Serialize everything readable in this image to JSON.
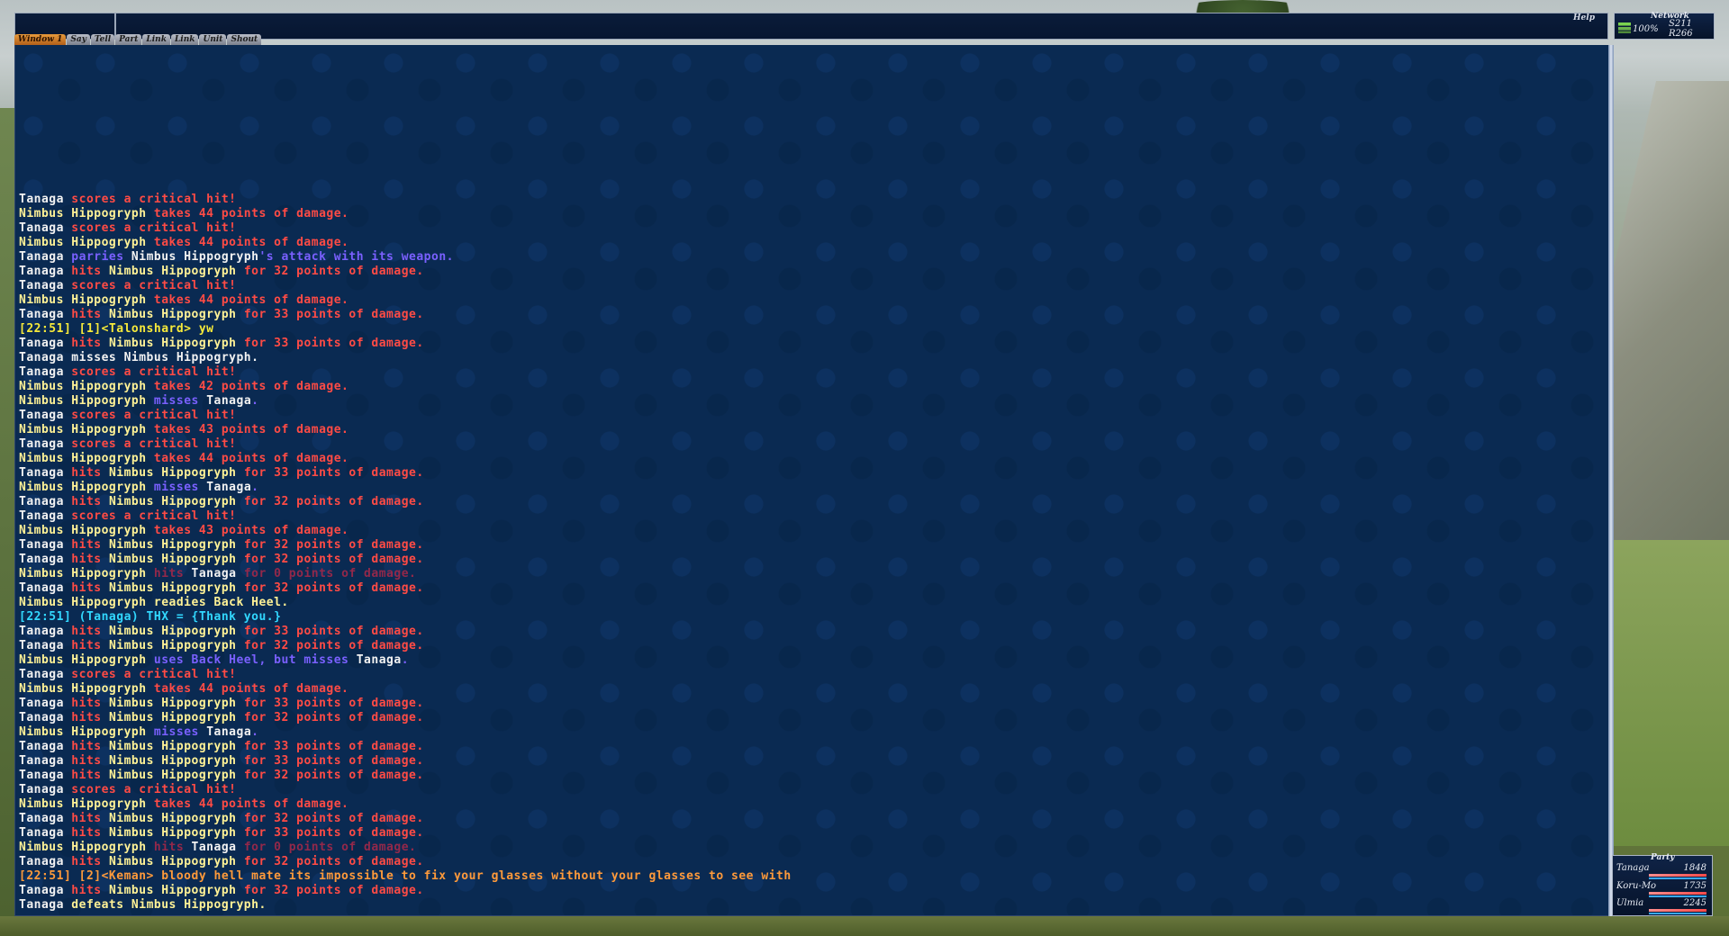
{
  "header": {
    "help_label": "Help"
  },
  "tabs": [
    {
      "label": "Window 1",
      "active": true
    },
    {
      "label": "Say"
    },
    {
      "label": "Tell"
    },
    {
      "label": "Part"
    },
    {
      "label": "Link"
    },
    {
      "label": "Link"
    },
    {
      "label": "Unit"
    },
    {
      "label": "Shout"
    }
  ],
  "network": {
    "title": "Network",
    "percent": "100%",
    "s": "S211",
    "r": "R266"
  },
  "party": {
    "title": "Party",
    "members": [
      {
        "name": "Tanaga",
        "hp": "1848",
        "hp_fraction": 1.0
      },
      {
        "name": "Koru-Mo",
        "hp": "1735",
        "hp_fraction": 1.0
      },
      {
        "name": "Ulmia",
        "hp": "2245",
        "hp_fraction": 1.0
      }
    ]
  },
  "chat_colors": {
    "white": "#f2f2f2",
    "yellow": "#fff296",
    "red": "#ff4b45",
    "blue": "#7a60ff",
    "darkred": "#93284a",
    "cyan": "#32d8ff",
    "linkshell": "#f7ea3a",
    "linkshell2": "#ff9a3a"
  },
  "chat_lines": [
    [
      [
        "w",
        "Tanaga "
      ],
      [
        "r",
        "scores a critical hit!"
      ]
    ],
    [
      [
        "y",
        "Nimbus Hippogryph "
      ],
      [
        "r",
        "takes 44 points of damage."
      ]
    ],
    [
      [
        "w",
        "Tanaga "
      ],
      [
        "r",
        "scores a critical hit!"
      ]
    ],
    [
      [
        "y",
        "Nimbus Hippogryph "
      ],
      [
        "r",
        "takes 44 points of damage."
      ]
    ],
    [
      [
        "w",
        "Tanaga "
      ],
      [
        "b",
        "parries "
      ],
      [
        "w",
        "Nimbus Hippogryph"
      ],
      [
        "b",
        "'s attack with its weapon."
      ]
    ],
    [
      [
        "w",
        "Tanaga "
      ],
      [
        "r",
        "hits "
      ],
      [
        "y",
        "Nimbus Hippogryph "
      ],
      [
        "r",
        "for 32 points of damage."
      ]
    ],
    [
      [
        "w",
        "Tanaga "
      ],
      [
        "r",
        "scores a critical hit!"
      ]
    ],
    [
      [
        "y",
        "Nimbus Hippogryph "
      ],
      [
        "r",
        "takes 44 points of damage."
      ]
    ],
    [
      [
        "w",
        "Tanaga "
      ],
      [
        "r",
        "hits "
      ],
      [
        "y",
        "Nimbus Hippogryph "
      ],
      [
        "r",
        "for 33 points of damage."
      ]
    ],
    [
      [
        "yl",
        "[22:51] [1]<Talonshard> yw"
      ]
    ],
    [
      [
        "w",
        "Tanaga "
      ],
      [
        "r",
        "hits "
      ],
      [
        "y",
        "Nimbus Hippogryph "
      ],
      [
        "r",
        "for 33 points of damage."
      ]
    ],
    [
      [
        "w",
        "Tanaga misses Nimbus Hippogryph."
      ]
    ],
    [
      [
        "w",
        "Tanaga "
      ],
      [
        "r",
        "scores a critical hit!"
      ]
    ],
    [
      [
        "y",
        "Nimbus Hippogryph "
      ],
      [
        "r",
        "takes 42 points of damage."
      ]
    ],
    [
      [
        "y",
        "Nimbus Hippogryph "
      ],
      [
        "b",
        "misses "
      ],
      [
        "w",
        "Tanaga"
      ],
      [
        "b",
        "."
      ]
    ],
    [
      [
        "w",
        "Tanaga "
      ],
      [
        "r",
        "scores a critical hit!"
      ]
    ],
    [
      [
        "y",
        "Nimbus Hippogryph "
      ],
      [
        "r",
        "takes 43 points of damage."
      ]
    ],
    [
      [
        "w",
        "Tanaga "
      ],
      [
        "r",
        "scores a critical hit!"
      ]
    ],
    [
      [
        "y",
        "Nimbus Hippogryph "
      ],
      [
        "r",
        "takes 44 points of damage."
      ]
    ],
    [
      [
        "w",
        "Tanaga "
      ],
      [
        "r",
        "hits "
      ],
      [
        "y",
        "Nimbus Hippogryph "
      ],
      [
        "r",
        "for 33 points of damage."
      ]
    ],
    [
      [
        "y",
        "Nimbus Hippogryph "
      ],
      [
        "b",
        "misses "
      ],
      [
        "w",
        "Tanaga"
      ],
      [
        "b",
        "."
      ]
    ],
    [
      [
        "w",
        "Tanaga "
      ],
      [
        "r",
        "hits "
      ],
      [
        "y",
        "Nimbus Hippogryph "
      ],
      [
        "r",
        "for 32 points of damage."
      ]
    ],
    [
      [
        "w",
        "Tanaga "
      ],
      [
        "r",
        "scores a critical hit!"
      ]
    ],
    [
      [
        "y",
        "Nimbus Hippogryph "
      ],
      [
        "r",
        "takes 43 points of damage."
      ]
    ],
    [
      [
        "w",
        "Tanaga "
      ],
      [
        "r",
        "hits "
      ],
      [
        "y",
        "Nimbus Hippogryph "
      ],
      [
        "r",
        "for 32 points of damage."
      ]
    ],
    [
      [
        "w",
        "Tanaga "
      ],
      [
        "r",
        "hits "
      ],
      [
        "y",
        "Nimbus Hippogryph "
      ],
      [
        "r",
        "for 32 points of damage."
      ]
    ],
    [
      [
        "y",
        "Nimbus Hippogryph "
      ],
      [
        "dr",
        "hits "
      ],
      [
        "w",
        "Tanaga "
      ],
      [
        "dr",
        "for 0 points of damage."
      ]
    ],
    [
      [
        "w",
        "Tanaga "
      ],
      [
        "r",
        "hits "
      ],
      [
        "y",
        "Nimbus Hippogryph "
      ],
      [
        "r",
        "for 32 points of damage."
      ]
    ],
    [
      [
        "y",
        "Nimbus Hippogryph readies Back Heel."
      ]
    ],
    [
      [
        "c",
        "[22:51] (Tanaga) THX = "
      ],
      [
        "c",
        "{Thank you.}"
      ]
    ],
    [
      [
        "w",
        "Tanaga "
      ],
      [
        "r",
        "hits "
      ],
      [
        "y",
        "Nimbus Hippogryph "
      ],
      [
        "r",
        "for 33 points of damage."
      ]
    ],
    [
      [
        "w",
        "Tanaga "
      ],
      [
        "r",
        "hits "
      ],
      [
        "y",
        "Nimbus Hippogryph "
      ],
      [
        "r",
        "for 32 points of damage."
      ]
    ],
    [
      [
        "y",
        "Nimbus Hippogryph "
      ],
      [
        "b",
        "uses Back Heel, but misses "
      ],
      [
        "w",
        "Tanaga"
      ],
      [
        "b",
        "."
      ]
    ],
    [
      [
        "w",
        "Tanaga "
      ],
      [
        "r",
        "scores a critical hit!"
      ]
    ],
    [
      [
        "y",
        "Nimbus Hippogryph "
      ],
      [
        "r",
        "takes 44 points of damage."
      ]
    ],
    [
      [
        "w",
        "Tanaga "
      ],
      [
        "r",
        "hits "
      ],
      [
        "y",
        "Nimbus Hippogryph "
      ],
      [
        "r",
        "for 33 points of damage."
      ]
    ],
    [
      [
        "w",
        "Tanaga "
      ],
      [
        "r",
        "hits "
      ],
      [
        "y",
        "Nimbus Hippogryph "
      ],
      [
        "r",
        "for 32 points of damage."
      ]
    ],
    [
      [
        "y",
        "Nimbus Hippogryph "
      ],
      [
        "b",
        "misses "
      ],
      [
        "w",
        "Tanaga"
      ],
      [
        "b",
        "."
      ]
    ],
    [
      [
        "w",
        "Tanaga "
      ],
      [
        "r",
        "hits "
      ],
      [
        "y",
        "Nimbus Hippogryph "
      ],
      [
        "r",
        "for 33 points of damage."
      ]
    ],
    [
      [
        "w",
        "Tanaga "
      ],
      [
        "r",
        "hits "
      ],
      [
        "y",
        "Nimbus Hippogryph "
      ],
      [
        "r",
        "for 33 points of damage."
      ]
    ],
    [
      [
        "w",
        "Tanaga "
      ],
      [
        "r",
        "hits "
      ],
      [
        "y",
        "Nimbus Hippogryph "
      ],
      [
        "r",
        "for 32 points of damage."
      ]
    ],
    [
      [
        "w",
        "Tanaga "
      ],
      [
        "r",
        "scores a critical hit!"
      ]
    ],
    [
      [
        "y",
        "Nimbus Hippogryph "
      ],
      [
        "r",
        "takes 44 points of damage."
      ]
    ],
    [
      [
        "w",
        "Tanaga "
      ],
      [
        "r",
        "hits "
      ],
      [
        "y",
        "Nimbus Hippogryph "
      ],
      [
        "r",
        "for 32 points of damage."
      ]
    ],
    [
      [
        "w",
        "Tanaga "
      ],
      [
        "r",
        "hits "
      ],
      [
        "y",
        "Nimbus Hippogryph "
      ],
      [
        "r",
        "for 33 points of damage."
      ]
    ],
    [
      [
        "y",
        "Nimbus Hippogryph "
      ],
      [
        "dr",
        "hits "
      ],
      [
        "w",
        "Tanaga "
      ],
      [
        "dr",
        "for 0 points of damage."
      ]
    ],
    [
      [
        "w",
        "Tanaga "
      ],
      [
        "r",
        "hits "
      ],
      [
        "y",
        "Nimbus Hippogryph "
      ],
      [
        "r",
        "for 32 points of damage."
      ]
    ],
    [
      [
        "o",
        "[22:51] [2]<Keman> bloody hell mate its impossible to fix your glasses without your glasses to see with"
      ]
    ],
    [
      [
        "w",
        "Tanaga "
      ],
      [
        "r",
        "hits "
      ],
      [
        "y",
        "Nimbus Hippogryph "
      ],
      [
        "r",
        "for 32 points of damage."
      ]
    ],
    [
      [
        "w",
        "Tanaga "
      ],
      [
        "y",
        "defeats Nimbus Hippogryph."
      ]
    ]
  ]
}
